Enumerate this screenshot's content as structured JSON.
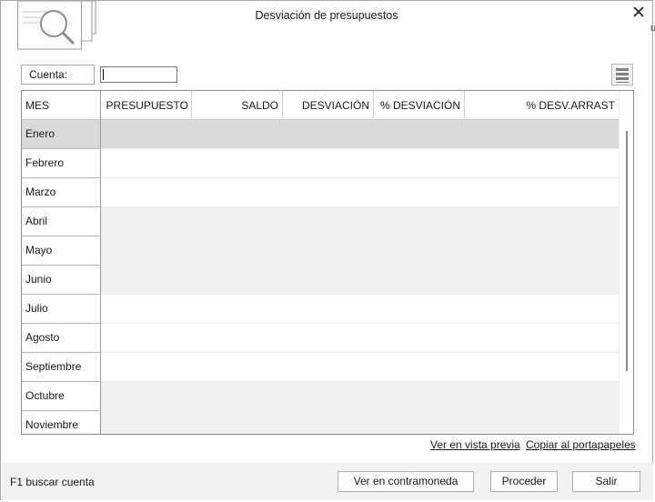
{
  "window": {
    "title": "Desviación de presupuestos",
    "edge_letter": "u"
  },
  "filter": {
    "cuenta_label": "Cuenta:",
    "cuenta_value": ""
  },
  "icons": {
    "app": "magnifier-documents-icon",
    "close": "close-icon",
    "menu": "hamburger-menu-icon"
  },
  "table": {
    "columns": [
      "MES",
      "PRESUPUESTO",
      "SALDO",
      "DESVIACIÓN",
      "% DESVIACIÓN",
      "% DESV.ARRAST"
    ],
    "rows": [
      {
        "mes": "Enero"
      },
      {
        "mes": "Febrero"
      },
      {
        "mes": "Marzo"
      },
      {
        "mes": "Abril"
      },
      {
        "mes": "Mayo"
      },
      {
        "mes": "Junio"
      },
      {
        "mes": "Julio"
      },
      {
        "mes": "Agosto"
      },
      {
        "mes": "Septiembre"
      },
      {
        "mes": "Octubre"
      },
      {
        "mes": "Noviembre"
      }
    ],
    "selected_row": "Enero"
  },
  "links": {
    "preview": "Ver en vista previa",
    "clipboard": "Copiar al portapapeles"
  },
  "footer": {
    "hint": "F1 buscar cuenta",
    "contramoneda": "Ver en contramoneda",
    "proceder": "Proceder",
    "salir": "Salir"
  },
  "colors": {
    "selected_row": "#d9d9d9",
    "shaded_band": "#f0f0f0",
    "footer_bg": "#f2f2f2"
  }
}
